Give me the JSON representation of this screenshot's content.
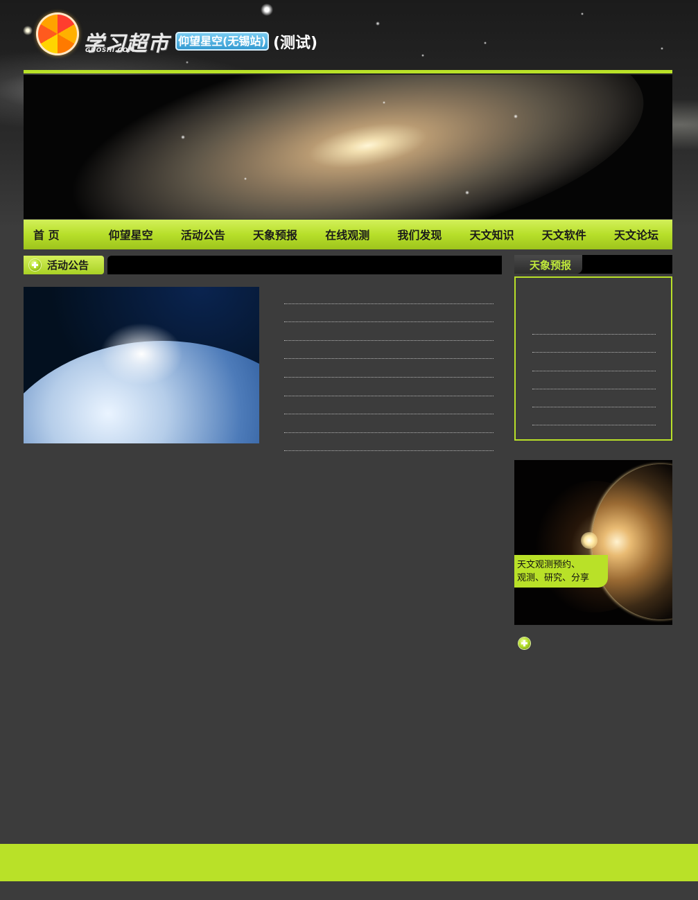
{
  "header": {
    "logo_title": "学习超市",
    "logo_subtitle": "GUOSHI.COM",
    "site_name": "仰望星空(无锡站)",
    "site_tag": "(测试)"
  },
  "nav": {
    "items": [
      {
        "label": "首 页"
      },
      {
        "label": "仰望星空"
      },
      {
        "label": "活动公告"
      },
      {
        "label": "天象预报"
      },
      {
        "label": "在线观测"
      },
      {
        "label": "我们发现"
      },
      {
        "label": "天文知识"
      },
      {
        "label": "天文软件"
      },
      {
        "label": "天文论坛"
      }
    ]
  },
  "main": {
    "section_title": "活动公告",
    "list_rows": 9
  },
  "sidebar": {
    "forecast_title": "天象预报",
    "forecast_rows": 6,
    "promo_caption_line1": "天文观测预约、",
    "promo_caption_line2": "观测、研究、分享"
  },
  "colors": {
    "accent": "#b9e128",
    "background": "#3c3c3c",
    "banner_black": "#000000"
  }
}
